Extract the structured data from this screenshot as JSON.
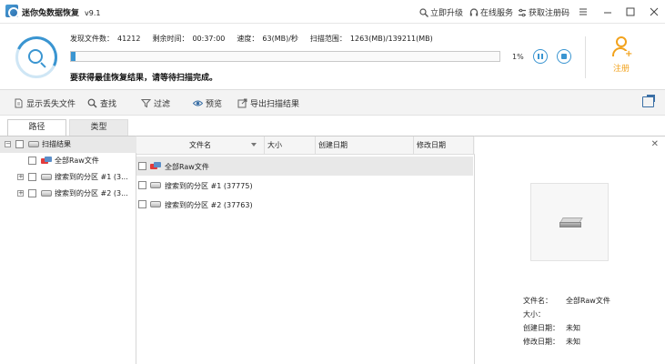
{
  "titlebar": {
    "title": "迷你兔数据恢复",
    "version": "v9.1",
    "upgrade": "立即升级",
    "service": "在线服务",
    "regcode": "获取注册码"
  },
  "scan": {
    "found_label": "发现文件数：",
    "found_value": "41212",
    "remaining_label": "剩余时间：",
    "remaining_value": "00:37:00",
    "speed_label": "速度：",
    "speed_value": "63(MB)/秒",
    "range_label": "扫描范围：",
    "range_value": "1263(MB)/139211(MB)",
    "progress_percent": 1,
    "percent_text": "1%",
    "hint": "要获得最佳恢复结果，请等待扫描完成。",
    "register_label": "注册"
  },
  "toolbar": {
    "show_lost": "显示丢失文件",
    "find": "查找",
    "filter": "过滤",
    "preview": "预览",
    "export": "导出扫描结果"
  },
  "tabs": {
    "path": "路径",
    "type": "类型"
  },
  "tree": {
    "root": "扫描结果",
    "items": [
      "全部Raw文件",
      "搜索到的分区 #1 (3...",
      "搜索到的分区 #2 (3..."
    ]
  },
  "table": {
    "headers": [
      "文件名",
      "大小",
      "创建日期",
      "修改日期"
    ],
    "rows": [
      {
        "name": "全部Raw文件"
      },
      {
        "name": "搜索到的分区 #1 (37775)"
      },
      {
        "name": "搜索到的分区 #2 (37763)"
      }
    ]
  },
  "details": {
    "filename_label": "文件名：",
    "filename_value": "全部Raw文件",
    "size_label": "大小：",
    "size_value": "",
    "created_label": "创建日期：",
    "created_value": "未知",
    "modified_label": "修改日期：",
    "modified_value": "未知"
  },
  "colors": {
    "accent": "#3a95d1",
    "register": "#f2a21c"
  }
}
